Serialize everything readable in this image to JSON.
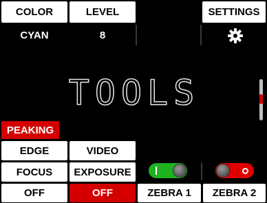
{
  "top": {
    "color_label": "COLOR",
    "level_label": "LEVEL",
    "settings_label": "SETTINGS",
    "color_value": "CYAN",
    "level_value": "8",
    "settings_icon": "gear-icon"
  },
  "title": "TOOLS",
  "left_menu": {
    "peaking": "PEAKING",
    "edge": "EDGE",
    "video": "VIDEO",
    "focus": "FOCUS",
    "exposure": "EXPOSURE",
    "off_1": "OFF",
    "off_2": "OFF"
  },
  "zebra": {
    "zebra1_label": "ZEBRA 1",
    "zebra2_label": "ZEBRA 2",
    "zebra1_state": "on",
    "zebra2_state": "off"
  },
  "colors": {
    "active_red": "#d40000",
    "toggle_on": "#1fb21f",
    "toggle_off": "#e00000"
  }
}
